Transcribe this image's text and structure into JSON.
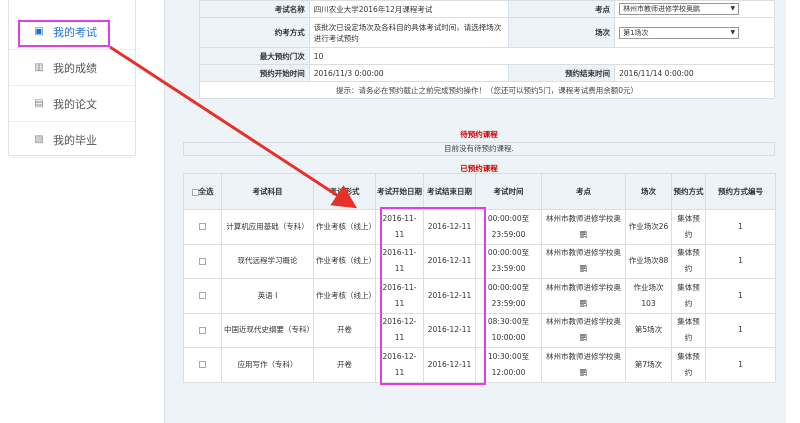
{
  "sidebar": {
    "items": [
      {
        "label": "我的考试",
        "icon": "calendar-icon",
        "active": true
      },
      {
        "label": "我的成绩",
        "icon": "bar-chart-icon",
        "active": false
      },
      {
        "label": "我的论文",
        "icon": "document-icon",
        "active": false
      },
      {
        "label": "我的毕业",
        "icon": "diploma-icon",
        "active": false
      }
    ]
  },
  "info": {
    "exam_name_label": "考试名称",
    "exam_name_value": "四川农业大学2016年12月课程考试",
    "site_label": "考点",
    "site_value": "林州市教师进修学校奥鹏",
    "method_label": "约考方式",
    "method_value": "该批次已设定场次及各科目的具体考试时间，请选择场次进行考试预约",
    "session_label": "场次",
    "session_value": "第1场次",
    "max_label": "最大预约门次",
    "max_value": "10",
    "start_label": "预约开始时间",
    "start_value": "2016/11/3 0:00:00",
    "end_label": "预约结束时间",
    "end_value": "2016/11/14 0:00:00",
    "tip": "提示：请务必在预约截止之前完成预约操作！（您还可以预约5门，课程考试费用余额0元）"
  },
  "pending": {
    "title": "待预约课程",
    "empty_text": "目前没有待预约课程."
  },
  "booked": {
    "title": "已预约课程",
    "headers": [
      "全选",
      "考试科目",
      "考试形式",
      "考试开始日期",
      "考试结束日期",
      "考试时间",
      "考点",
      "场次",
      "预约方式",
      "预约方式编号"
    ],
    "rows": [
      {
        "subject": "计算机应用基础（专科）",
        "form": "作业考核（线上）",
        "start": "2016-11-11",
        "end": "2016-12-11",
        "time": "00:00:00至23:59:00",
        "site": "林州市教师进修学校奥鹏",
        "session": "作业场次26",
        "mode": "集体预约",
        "code": "1"
      },
      {
        "subject": "现代远程学习概论",
        "form": "作业考核（线上）",
        "start": "2016-11-11",
        "end": "2016-12-11",
        "time": "00:00:00至23:59:00",
        "site": "林州市教师进修学校奥鹏",
        "session": "作业场次88",
        "mode": "集体预约",
        "code": "1"
      },
      {
        "subject": "英语 I",
        "form": "作业考核（线上）",
        "start": "2016-11-11",
        "end": "2016-12-11",
        "time": "00:00:00至23:59:00",
        "site": "林州市教师进修学校奥鹏",
        "session": "作业场次103",
        "mode": "集体预约",
        "code": "1"
      },
      {
        "subject": "中国近现代史纲要（专科）",
        "form": "开卷",
        "start": "2016-12-11",
        "end": "2016-12-11",
        "time": "08:30:00至10:00:00",
        "site": "林州市教师进修学校奥鹏",
        "session": "第5场次",
        "mode": "集体预约",
        "code": "1"
      },
      {
        "subject": "应用写作（专科）",
        "form": "开卷",
        "start": "2016-12-11",
        "end": "2016-12-11",
        "time": "10:30:00至12:00:00",
        "site": "林州市教师进修学校奥鹏",
        "session": "第7场次",
        "mode": "集体预约",
        "code": "1"
      }
    ]
  },
  "colors": {
    "highlight": "#e040e0",
    "arrow": "#e8302a",
    "title_red": "#d20000",
    "link_blue": "#1f6fd8"
  }
}
